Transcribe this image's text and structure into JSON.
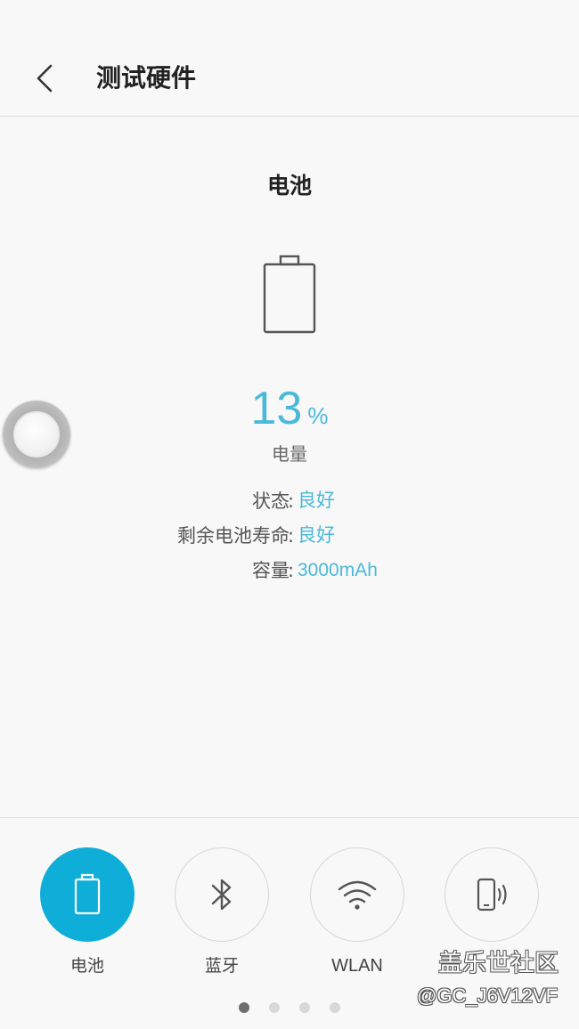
{
  "header": {
    "title": "测试硬件",
    "back_icon": "chevron-left-icon"
  },
  "battery": {
    "title": "电池",
    "icon": "battery-icon",
    "level_value": "13",
    "level_unit": "%",
    "level_label": "电量",
    "level_fraction": 0.13,
    "details": [
      {
        "key": "状态",
        "sep": ":",
        "value": "良好"
      },
      {
        "key": "剩余电池寿命",
        "sep": ":",
        "value": "良好"
      },
      {
        "key": "容量",
        "sep": ":",
        "value": "3000mAh"
      }
    ]
  },
  "tabs": [
    {
      "label": "电池",
      "icon": "battery-icon",
      "active": true
    },
    {
      "label": "蓝牙",
      "icon": "bluetooth-icon",
      "active": false
    },
    {
      "label": "WLAN",
      "icon": "wifi-icon",
      "active": false
    },
    {
      "label": "",
      "icon": "phone-vibrate-icon",
      "active": false
    }
  ],
  "pager": {
    "count": 4,
    "active_index": 0
  },
  "watermark": {
    "title": "盖乐世社区",
    "user": "@GC_J6V12VF"
  },
  "colors": {
    "accent": "#4ab9d9",
    "active_tab": "#0eaed8",
    "background": "#f8f8f8"
  }
}
